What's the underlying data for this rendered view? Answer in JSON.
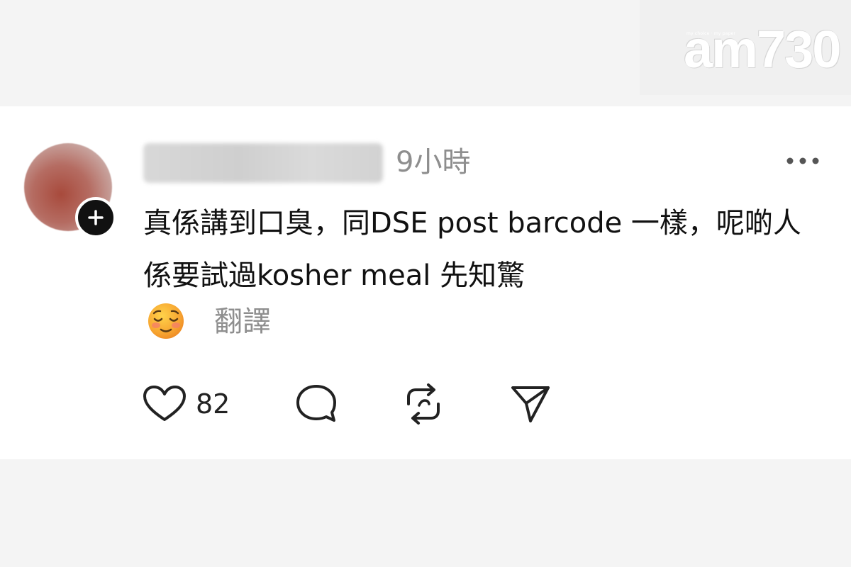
{
  "watermark": {
    "tagline": "my choice · my paper",
    "brand": "am730"
  },
  "post": {
    "timestamp": "9小時",
    "text": "真係講到口臭，同DSE post barcode 一樣，呢啲人係要試過kosher meal 先知驚",
    "translate_label": "翻譯",
    "emoji": "relieved-face",
    "likes": "82"
  },
  "colors": {
    "text": "#111111",
    "muted": "#8e8e8e",
    "card": "#ffffff",
    "background": "#f4f4f4"
  },
  "icons": {
    "more": "more-horizontal-icon",
    "like": "heart-icon",
    "reply": "comment-bubble-icon",
    "repost": "repost-icon",
    "share": "send-icon",
    "follow": "plus-icon"
  }
}
